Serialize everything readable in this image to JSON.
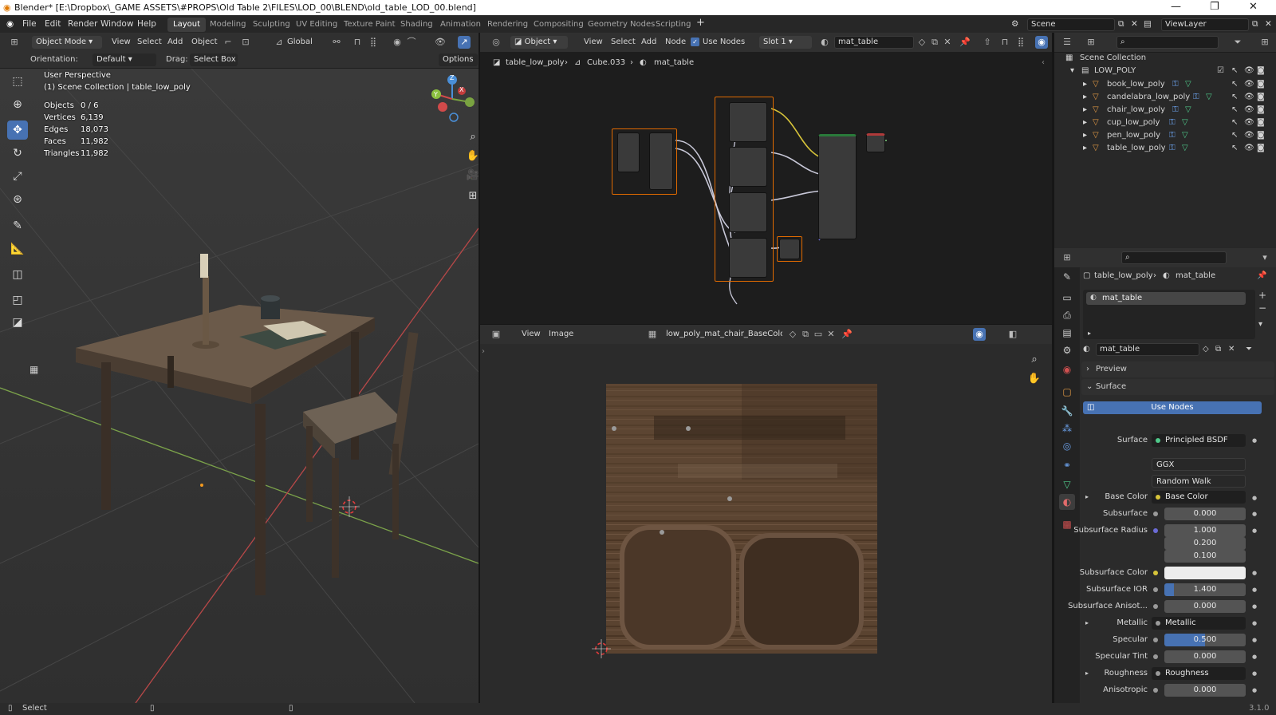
{
  "window": {
    "title": "Blender* [E:\\Dropbox\\_GAME ASSETS\\#PROPS\\Old Table 2\\FILES\\LOD_00\\BLEND\\old_table_LOD_00.blend]",
    "minimize": "—",
    "maximize": "❐",
    "close": "✕"
  },
  "menu": {
    "items": [
      "File",
      "Edit",
      "Render",
      "Window",
      "Help"
    ]
  },
  "workspaces": [
    "Layout",
    "Modeling",
    "Sculpting",
    "UV Editing",
    "Texture Paint",
    "Shading",
    "Animation",
    "Rendering",
    "Compositing",
    "Geometry Nodes",
    "Scripting"
  ],
  "scene": {
    "name": "Scene",
    "view_layer": "ViewLayer"
  },
  "viewport_header": {
    "mode": "Object Mode",
    "menus": [
      "View",
      "Select",
      "Add",
      "Object"
    ],
    "transform": "Global"
  },
  "tool_settings": {
    "orientation_label": "Orientation:",
    "orientation": "Default",
    "drag_label": "Drag:",
    "drag": "Select Box",
    "options": "Options"
  },
  "viewport": {
    "perspective": "User Perspective",
    "collection": "(1) Scene Collection | table_low_poly",
    "stats": [
      {
        "label": "Objects",
        "value": "0 / 6"
      },
      {
        "label": "Vertices",
        "value": "6,139"
      },
      {
        "label": "Edges",
        "value": "18,073"
      },
      {
        "label": "Faces",
        "value": "11,982"
      },
      {
        "label": "Triangles",
        "value": "11,982"
      }
    ],
    "gizmo": {
      "x": "X",
      "y": "Y",
      "z": "Z"
    }
  },
  "node_header": {
    "type": "Object",
    "menus": [
      "View",
      "Select",
      "Add",
      "Node"
    ],
    "use_nodes": "Use Nodes",
    "slot": "Slot 1",
    "material": "mat_table"
  },
  "node_breadcrumb": {
    "object": "table_low_poly",
    "mesh": "Cube.033",
    "material": "mat_table"
  },
  "image_editor": {
    "menus": [
      "View",
      "Image"
    ],
    "image": "low_poly_mat_chair_BaseColor.png"
  },
  "outliner": {
    "root": "Scene Collection",
    "collection": "LOW_POLY",
    "objects": [
      "book_low_poly",
      "candelabra_low_poly",
      "chair_low_poly",
      "cup_low_poly",
      "pen_low_poly",
      "table_low_poly"
    ]
  },
  "properties": {
    "object": "table_low_poly",
    "material": "mat_table",
    "slot_item": "mat_table",
    "material_field": "mat_table",
    "panels": {
      "preview": "Preview",
      "surface": "Surface"
    },
    "use_nodes": "Use Nodes",
    "surface_label": "Surface",
    "surface_value": "Principled BSDF",
    "distribution": "GGX",
    "subsurface_method": "Random Walk",
    "base_color_label": "Base Color",
    "base_color_value": "Base Color",
    "subsurface_label": "Subsurface",
    "subsurface_value": "0.000",
    "radius_label": "Subsurface Radius",
    "radius": [
      "1.000",
      "0.200",
      "0.100"
    ],
    "sss_color_label": "Subsurface Color",
    "sss_ior_label": "Subsurface IOR",
    "sss_ior_value": "1.400",
    "sss_aniso_label": "Subsurface Anisot...",
    "sss_aniso_value": "0.000",
    "metallic_label": "Metallic",
    "metallic_value": "Metallic",
    "specular_label": "Specular",
    "specular_value": "0.500",
    "spec_tint_label": "Specular Tint",
    "spec_tint_value": "0.000",
    "roughness_label": "Roughness",
    "roughness_value": "Roughness",
    "aniso_label": "Anisotropic",
    "aniso_value": "0.000"
  },
  "status": {
    "left": "Select",
    "version": "3.1.0"
  },
  "colors": {
    "accent": "#4772b3",
    "selection": "#e06a00",
    "header": "#303030",
    "panel": "#2b2b2b"
  }
}
